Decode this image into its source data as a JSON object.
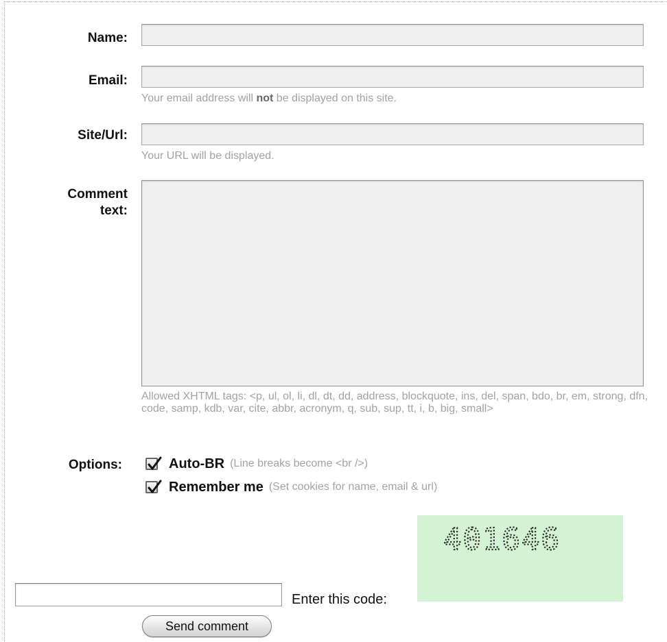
{
  "form": {
    "name": {
      "label": "Name:",
      "value": ""
    },
    "email": {
      "label": "Email:",
      "value": "",
      "note_before": "Your email address will ",
      "note_bold": "not",
      "note_after": " be displayed on this site."
    },
    "url": {
      "label": "Site/Url:",
      "value": "",
      "note": "Your URL will be displayed."
    },
    "comment": {
      "label_line1": "Comment",
      "label_line2": "text:",
      "value": "",
      "allowed_tags": "Allowed XHTML tags: <p, ul, ol, li, dl, dt, dd, address, blockquote, ins, del, span, bdo, br, em, strong, dfn, code, samp, kdb, var, cite, abbr, acronym, q, sub, sup, tt, i, b, big, small>"
    },
    "options": {
      "label": "Options:",
      "items": [
        {
          "label": "Auto-BR",
          "hint": "(Line breaks become <br />)",
          "checked": true
        },
        {
          "label": "Remember me",
          "hint": "(Set cookies for name, email & url)",
          "checked": true
        }
      ]
    },
    "captcha": {
      "input_value": "",
      "label": "Enter this code:",
      "code": "401646",
      "background": "#d3f3d4"
    },
    "submit_label": "Send comment"
  }
}
